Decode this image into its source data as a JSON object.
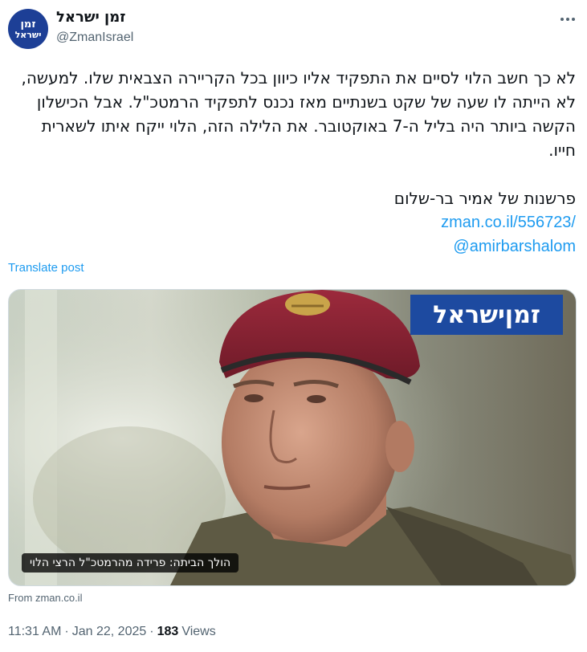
{
  "author": {
    "avatar_line1": "זמן",
    "avatar_line2": "ישראל",
    "display_name": "זמן ישראל",
    "handle": "@ZmanIsrael"
  },
  "header": {
    "more_icon": "more-horizontal-icon"
  },
  "tweet": {
    "paragraph": "לא כך חשב הלוי לסיים את התפקיד אליו כיוון בכל הקריירה הצבאית שלו. למעשה, לא הייתה לו שעה של שקט בשנתיים מאז נכנס לתפקיד הרמטכ\"ל. אבל הכישלון הקשה ביותר היה בליל ה-7 באוקטובר. את הלילה הזה, הלוי ייקח איתו לשארית חייו.",
    "byline": "פרשנות של אמיר בר-שלום",
    "link": "zman.co.il/556723/",
    "mention": "@amirbarshalom"
  },
  "translate_label": "Translate post",
  "media": {
    "brand_text": "זמןישראל",
    "caption": "הולך הביתה: פרידה מהרמטכ\"ל הרצי הלוי"
  },
  "source_label": "From zman.co.il",
  "meta": {
    "time": "11:31 AM",
    "separator": "·",
    "date": "Jan 22, 2025",
    "views_count": "183",
    "views_label": "Views"
  },
  "colors": {
    "link": "#1d9bf0",
    "brand": "#1d4aa0",
    "secondary_text": "#536471"
  }
}
